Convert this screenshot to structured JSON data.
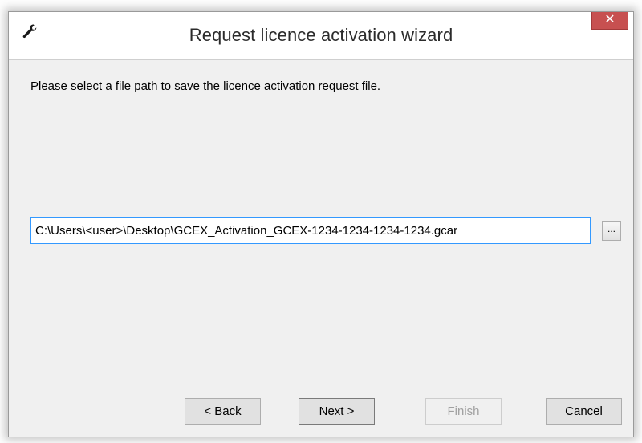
{
  "window": {
    "title": "Request licence activation wizard",
    "close_label": "✕"
  },
  "content": {
    "instruction": "Please select a file path to save the licence activation request file.",
    "file_path_value": "C:\\Users\\<user>\\Desktop\\GCEX_Activation_GCEX-1234-1234-1234-1234.gcar",
    "browse_label": "..."
  },
  "buttons": {
    "back_label": "< Back",
    "next_label": "Next >",
    "finish_label": "Finish",
    "cancel_label": "Cancel"
  },
  "icons": {
    "app": "wrench-icon",
    "close": "close-icon"
  },
  "colors": {
    "close_button": "#c75050",
    "input_focus_border": "#3399ff",
    "dialog_background": "#f0f0f0"
  }
}
